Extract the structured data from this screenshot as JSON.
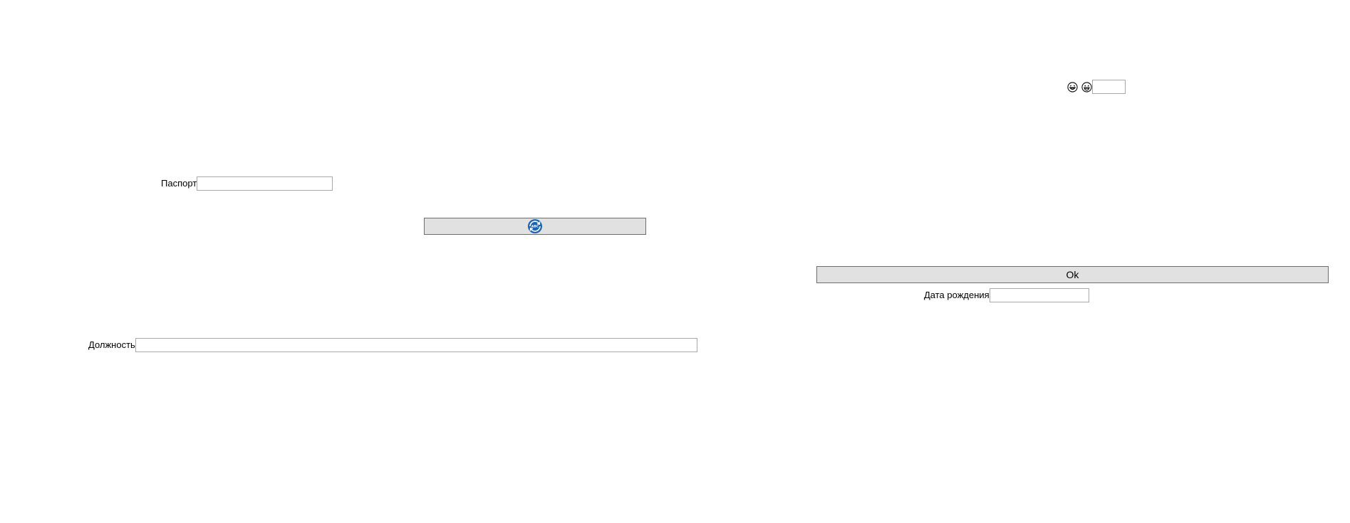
{
  "top_right": {
    "icons": [
      "laughing-face-icon",
      "grinning-face-icon"
    ],
    "input_value": ""
  },
  "passport": {
    "label": "Паспорт",
    "value": ""
  },
  "icon_button": {
    "icon": "refresh-globe-icon",
    "badge_text": "ABC",
    "accent": "#1565c0"
  },
  "ok_button": {
    "label": "Ok"
  },
  "birth_date": {
    "label": "Дата рождения",
    "value": ""
  },
  "position": {
    "label": "Должность",
    "value": ""
  }
}
